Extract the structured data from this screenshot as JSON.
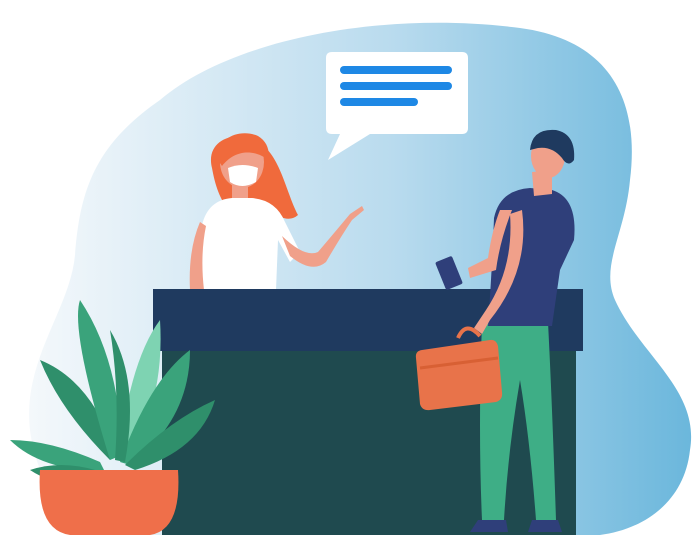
{
  "scene": {
    "description_name": "reception-desk-illustration",
    "elements": [
      "background-blob",
      "speech-bubble",
      "receptionist",
      "reception-desk",
      "visitor",
      "potted-plant"
    ]
  },
  "colors": {
    "blob_light": "#eef6fb",
    "blob_dark": "#6bb7dc",
    "bubble": "#ffffff",
    "bubble_lines": "#1e88e5",
    "desk_top": "#1f3a5f",
    "desk_body": "#1f4a4f",
    "skin": "#f0a08a",
    "hair_receptionist": "#f06a3c",
    "uniform": "#ffffff",
    "visitor_shirt": "#2f3f7a",
    "visitor_pants": "#3eae86",
    "visitor_hair": "#1f3a5f",
    "briefcase": "#e8734a",
    "plant_pot": "#ef6f4a",
    "plant_leaves_dark": "#2f8f6b",
    "plant_leaves_mid": "#3aa37b",
    "plant_leaves_light": "#7ed3b2"
  }
}
